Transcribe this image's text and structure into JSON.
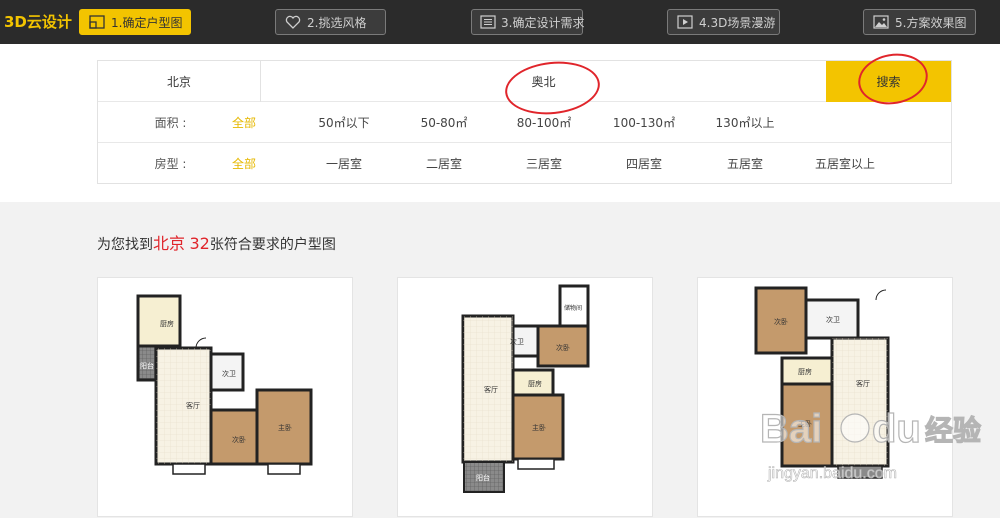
{
  "header": {
    "brand": "3D云设计",
    "steps": [
      {
        "label": "1.确定户型图",
        "icon": "floorplan-icon"
      },
      {
        "label": "2.挑选风格",
        "icon": "heart-icon"
      },
      {
        "label": "3.确定设计需求",
        "icon": "checklist-icon"
      },
      {
        "label": "4.3D场景漫游",
        "icon": "video-icon"
      },
      {
        "label": "5.方案效果图",
        "icon": "image-icon"
      }
    ]
  },
  "search": {
    "city": "北京",
    "query": "奥北",
    "button": "搜索"
  },
  "filters": {
    "area_label": "面积 :",
    "area_options": [
      "全部",
      "50㎡以下",
      "50-80㎡",
      "80-100㎡",
      "100-130㎡",
      "130㎡以上"
    ],
    "room_label": "房型 :",
    "room_options": [
      "全部",
      "一居室",
      "二居室",
      "三居室",
      "四居室",
      "五居室",
      "五居室以上"
    ]
  },
  "results": {
    "prefix": "为您找到",
    "city": "北京",
    "count": "32",
    "suffix": "张符合要求的户型图"
  },
  "plans": [
    {
      "rooms": [
        "厨房",
        "阳台",
        "客厅",
        "次卫",
        "次卧",
        "主卧"
      ]
    },
    {
      "rooms": [
        "储物间",
        "次卫",
        "次卧",
        "厨房",
        "客厅",
        "主卧",
        "阳台"
      ]
    },
    {
      "rooms": [
        "次卧",
        "次卫",
        "厨房",
        "客厅",
        "主卧"
      ]
    }
  ],
  "watermark": {
    "brand": "Bai",
    "brand2": "du",
    "cn": "经验",
    "url": "jingyan.baidu.com"
  },
  "colors": {
    "accent": "#f3c400",
    "topbar": "#2b2b2b",
    "highlight_red": "#e0252b"
  }
}
